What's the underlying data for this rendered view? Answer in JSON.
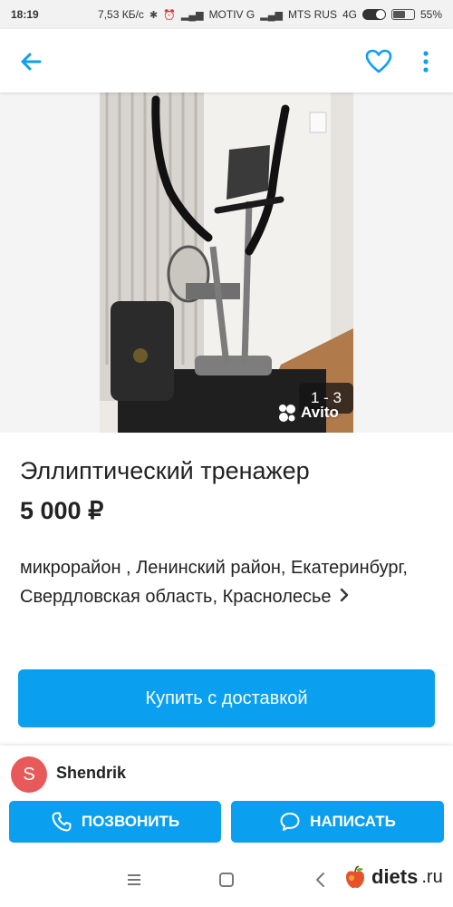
{
  "status_bar": {
    "time": "18:19",
    "speed": "7,53 КБ/с",
    "carrier1": "MOTIV G",
    "carrier2": "MTS RUS",
    "network": "4G",
    "battery": "55%"
  },
  "listing": {
    "photo_counter": "1 - 3",
    "watermark": "Avito",
    "title": "Эллиптический тренажер",
    "price": "5 000 ₽",
    "address": "микрорайон , Ленинский район, Екатеринбург, Свердловская область, Краснолесье",
    "buy_button": "Купить с доставкой"
  },
  "seller": {
    "avatar_letter": "S",
    "name": "Shendrik",
    "call_button": "ПОЗВОНИТЬ",
    "write_button": "НАПИСАТЬ"
  },
  "footer": {
    "brand": "diets",
    "brand_suffix": ".ru"
  },
  "colors": {
    "accent": "#0b9ff0",
    "avatar": "#e85a5a"
  },
  "icons": [
    "back-arrow-icon",
    "heart-icon",
    "more-vert-icon",
    "chevron-right-icon",
    "phone-icon",
    "chat-bubble-icon",
    "menu-icon",
    "home-square-icon",
    "nav-back-icon"
  ]
}
